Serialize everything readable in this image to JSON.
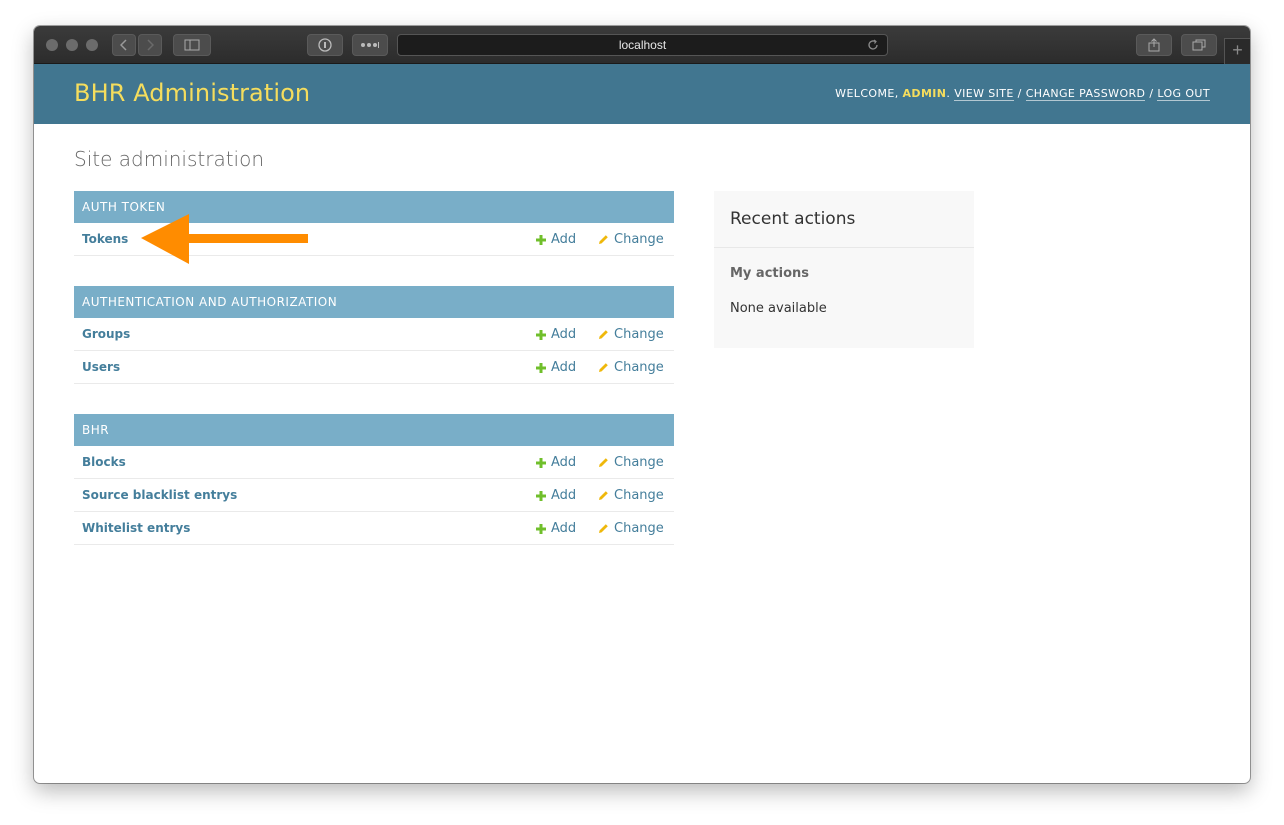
{
  "browser": {
    "url": "localhost",
    "icons": [
      "back-icon",
      "forward-icon",
      "sidebar-icon",
      "password-icon",
      "extensions-icon",
      "reload-icon",
      "share-icon",
      "tabs-icon",
      "new-tab-icon"
    ]
  },
  "header": {
    "branding": "BHR Administration",
    "welcome": "WELCOME, ",
    "username": "ADMIN",
    "period": ". ",
    "view_site": "VIEW SITE",
    "sep": " / ",
    "change_password": "CHANGE PASSWORD",
    "log_out": "LOG OUT"
  },
  "page_title": "Site administration",
  "modules": [
    {
      "caption": "AUTH TOKEN",
      "models": [
        {
          "name": "Tokens",
          "add": "Add",
          "change": "Change"
        }
      ]
    },
    {
      "caption": "AUTHENTICATION AND AUTHORIZATION",
      "models": [
        {
          "name": "Groups",
          "add": "Add",
          "change": "Change"
        },
        {
          "name": "Users",
          "add": "Add",
          "change": "Change"
        }
      ]
    },
    {
      "caption": "BHR",
      "models": [
        {
          "name": "Blocks",
          "add": "Add",
          "change": "Change"
        },
        {
          "name": "Source blacklist entrys",
          "add": "Add",
          "change": "Change"
        },
        {
          "name": "Whitelist entrys",
          "add": "Add",
          "change": "Change"
        }
      ]
    }
  ],
  "recent_actions": {
    "title": "Recent actions",
    "my_actions": "My actions",
    "empty": "None available"
  },
  "colors": {
    "header_bg": "#417690",
    "branding": "#f5dd5d",
    "caption_bg": "#79aec8",
    "link": "#447e9b",
    "add_icon": "#70bf2b",
    "change_icon": "#efb80b",
    "annotation_arrow": "#ff8c00"
  }
}
